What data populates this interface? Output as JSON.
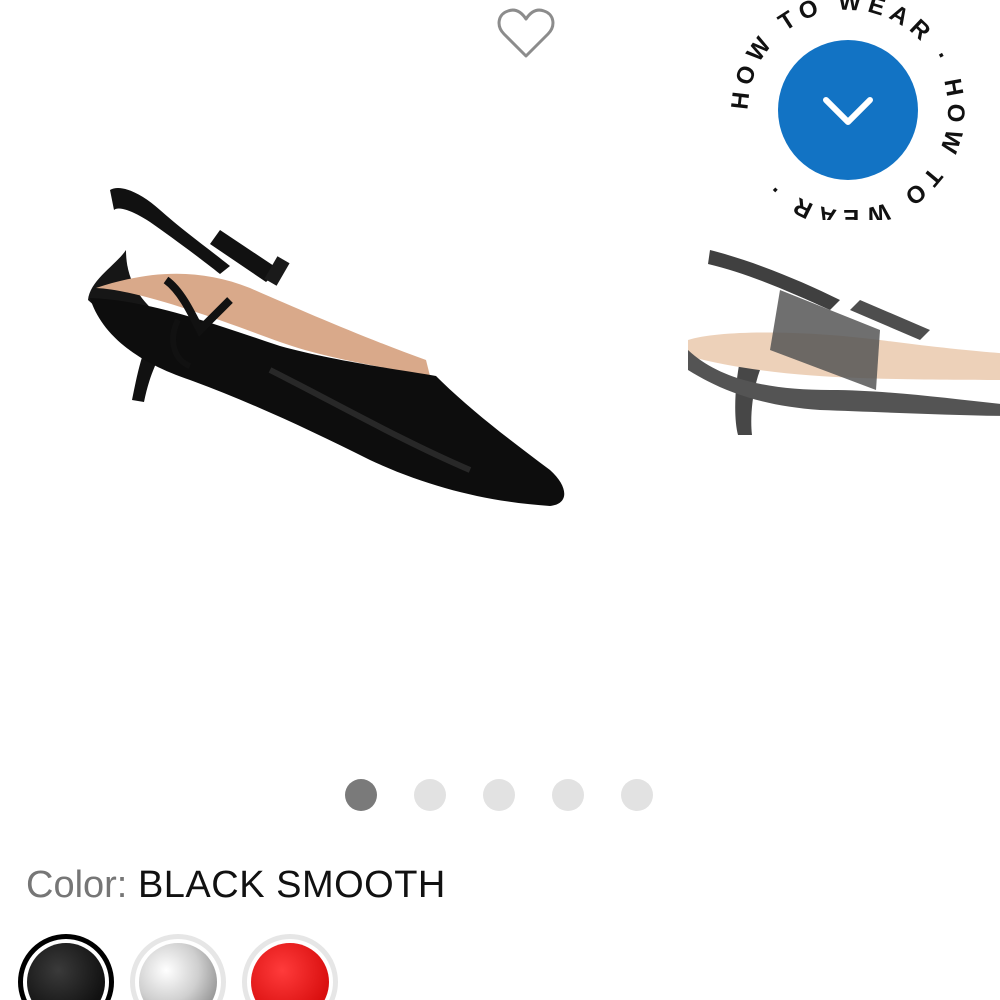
{
  "gallery": {
    "favorite_icon": "heart-outline-icon",
    "how_to_wear": {
      "ring_text": "HOW TO WEAR · HOW TO WEAR · ",
      "icon": "chevron-down-icon",
      "accent": "#1273c4"
    },
    "dots": [
      {
        "active": true
      },
      {
        "active": false
      },
      {
        "active": false
      },
      {
        "active": false
      },
      {
        "active": false
      }
    ]
  },
  "color": {
    "label": "Color:",
    "value": "BLACK SMOOTH"
  },
  "swatches": [
    {
      "name": "black-smooth",
      "color": "#1a1a1a",
      "selected": true
    },
    {
      "name": "silver",
      "color": "#d8d8d8",
      "selected": false
    },
    {
      "name": "red",
      "color": "#e11414",
      "selected": false
    }
  ]
}
